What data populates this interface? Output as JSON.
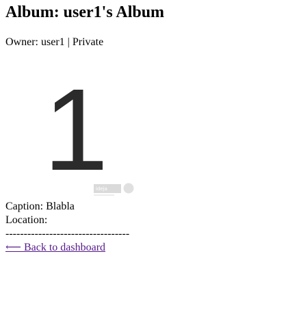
{
  "album": {
    "title": "Album: user1's Album",
    "owner_line": "Owner: user1 | Private"
  },
  "photo": {
    "digit": "1",
    "watermark": "ideja"
  },
  "details": {
    "caption": "Caption: Blabla",
    "location": "Location:",
    "divider": "----------------------------------"
  },
  "nav": {
    "back_link": "⟵ Back to dashboard"
  },
  "colors": {
    "text": "#000000",
    "visited_link": "#551a8b",
    "digit": "#2b2b2b"
  }
}
